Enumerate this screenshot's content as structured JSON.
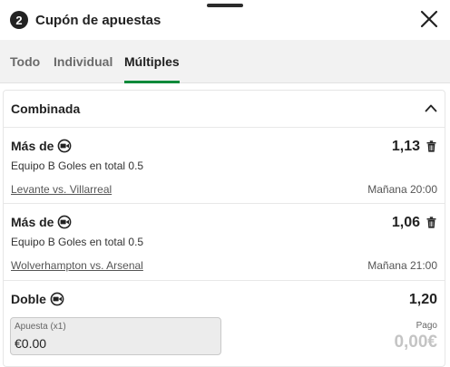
{
  "header": {
    "count": "2",
    "title": "Cupón de apuestas"
  },
  "tabs": [
    {
      "label": "Todo",
      "active": false
    },
    {
      "label": "Individual",
      "active": false
    },
    {
      "label": "Múltiples",
      "active": true
    }
  ],
  "section": {
    "title": "Combinada"
  },
  "bets": [
    {
      "selection": "Más de",
      "odds": "1,13",
      "market": "Equipo B Goles en total 0.5",
      "match": "Levante vs. Villarreal",
      "time": "Mañana 20:00"
    },
    {
      "selection": "Más de",
      "odds": "1,06",
      "market": "Equipo B Goles en total 0.5",
      "match": "Wolverhampton vs. Arsenal",
      "time": "Mañana 21:00"
    }
  ],
  "combo": {
    "title": "Doble",
    "odds": "1,20",
    "stake_label": "Apuesta (x1)",
    "stake_value": "€0.00",
    "payout_label": "Pago",
    "payout_value": "0,00€"
  },
  "colors": {
    "accent": "#0a8a3a",
    "tab_bar": "#f2f2f2",
    "payout_muted": "#c4c4c4"
  },
  "icons": [
    "close-icon",
    "chevron-up-icon",
    "live-stream-icon",
    "trash-icon"
  ]
}
